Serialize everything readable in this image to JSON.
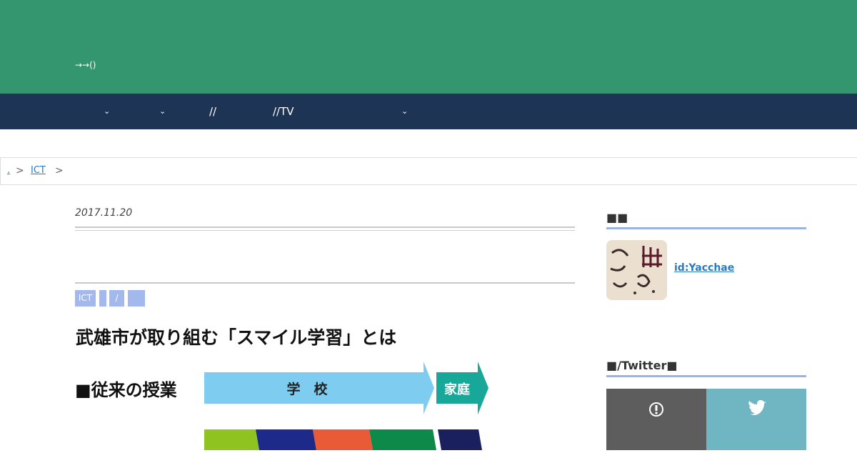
{
  "header": {
    "description": "→→()",
    "bg_color": "#33966e"
  },
  "nav": {
    "bg_color": "#1e3455",
    "items": [
      {
        "label": "",
        "has_chevron": true
      },
      {
        "label": "",
        "has_chevron": true
      },
      {
        "label": "//",
        "has_chevron": false
      },
      {
        "label": "//TV",
        "has_chevron": false
      },
      {
        "label": "",
        "has_chevron": true
      }
    ]
  },
  "breadcrumb": {
    "items": [
      ".",
      "ICT"
    ],
    "separator": ">"
  },
  "article": {
    "date": "2017.11.20",
    "tags": [
      "ICT",
      "",
      "/",
      ""
    ],
    "title": "武雄市が取り組む「スマイル学習」とは",
    "figure": {
      "row_label": "■従来の授業",
      "school_label": "学　校",
      "home_label": "家庭"
    }
  },
  "sidebar": {
    "profile_heading": "■■",
    "user_id": "id:Yacchae",
    "share_heading": "■/Twitter■",
    "share_left_icon": "hatena-icon",
    "share_right_icon": "twitter-icon"
  }
}
